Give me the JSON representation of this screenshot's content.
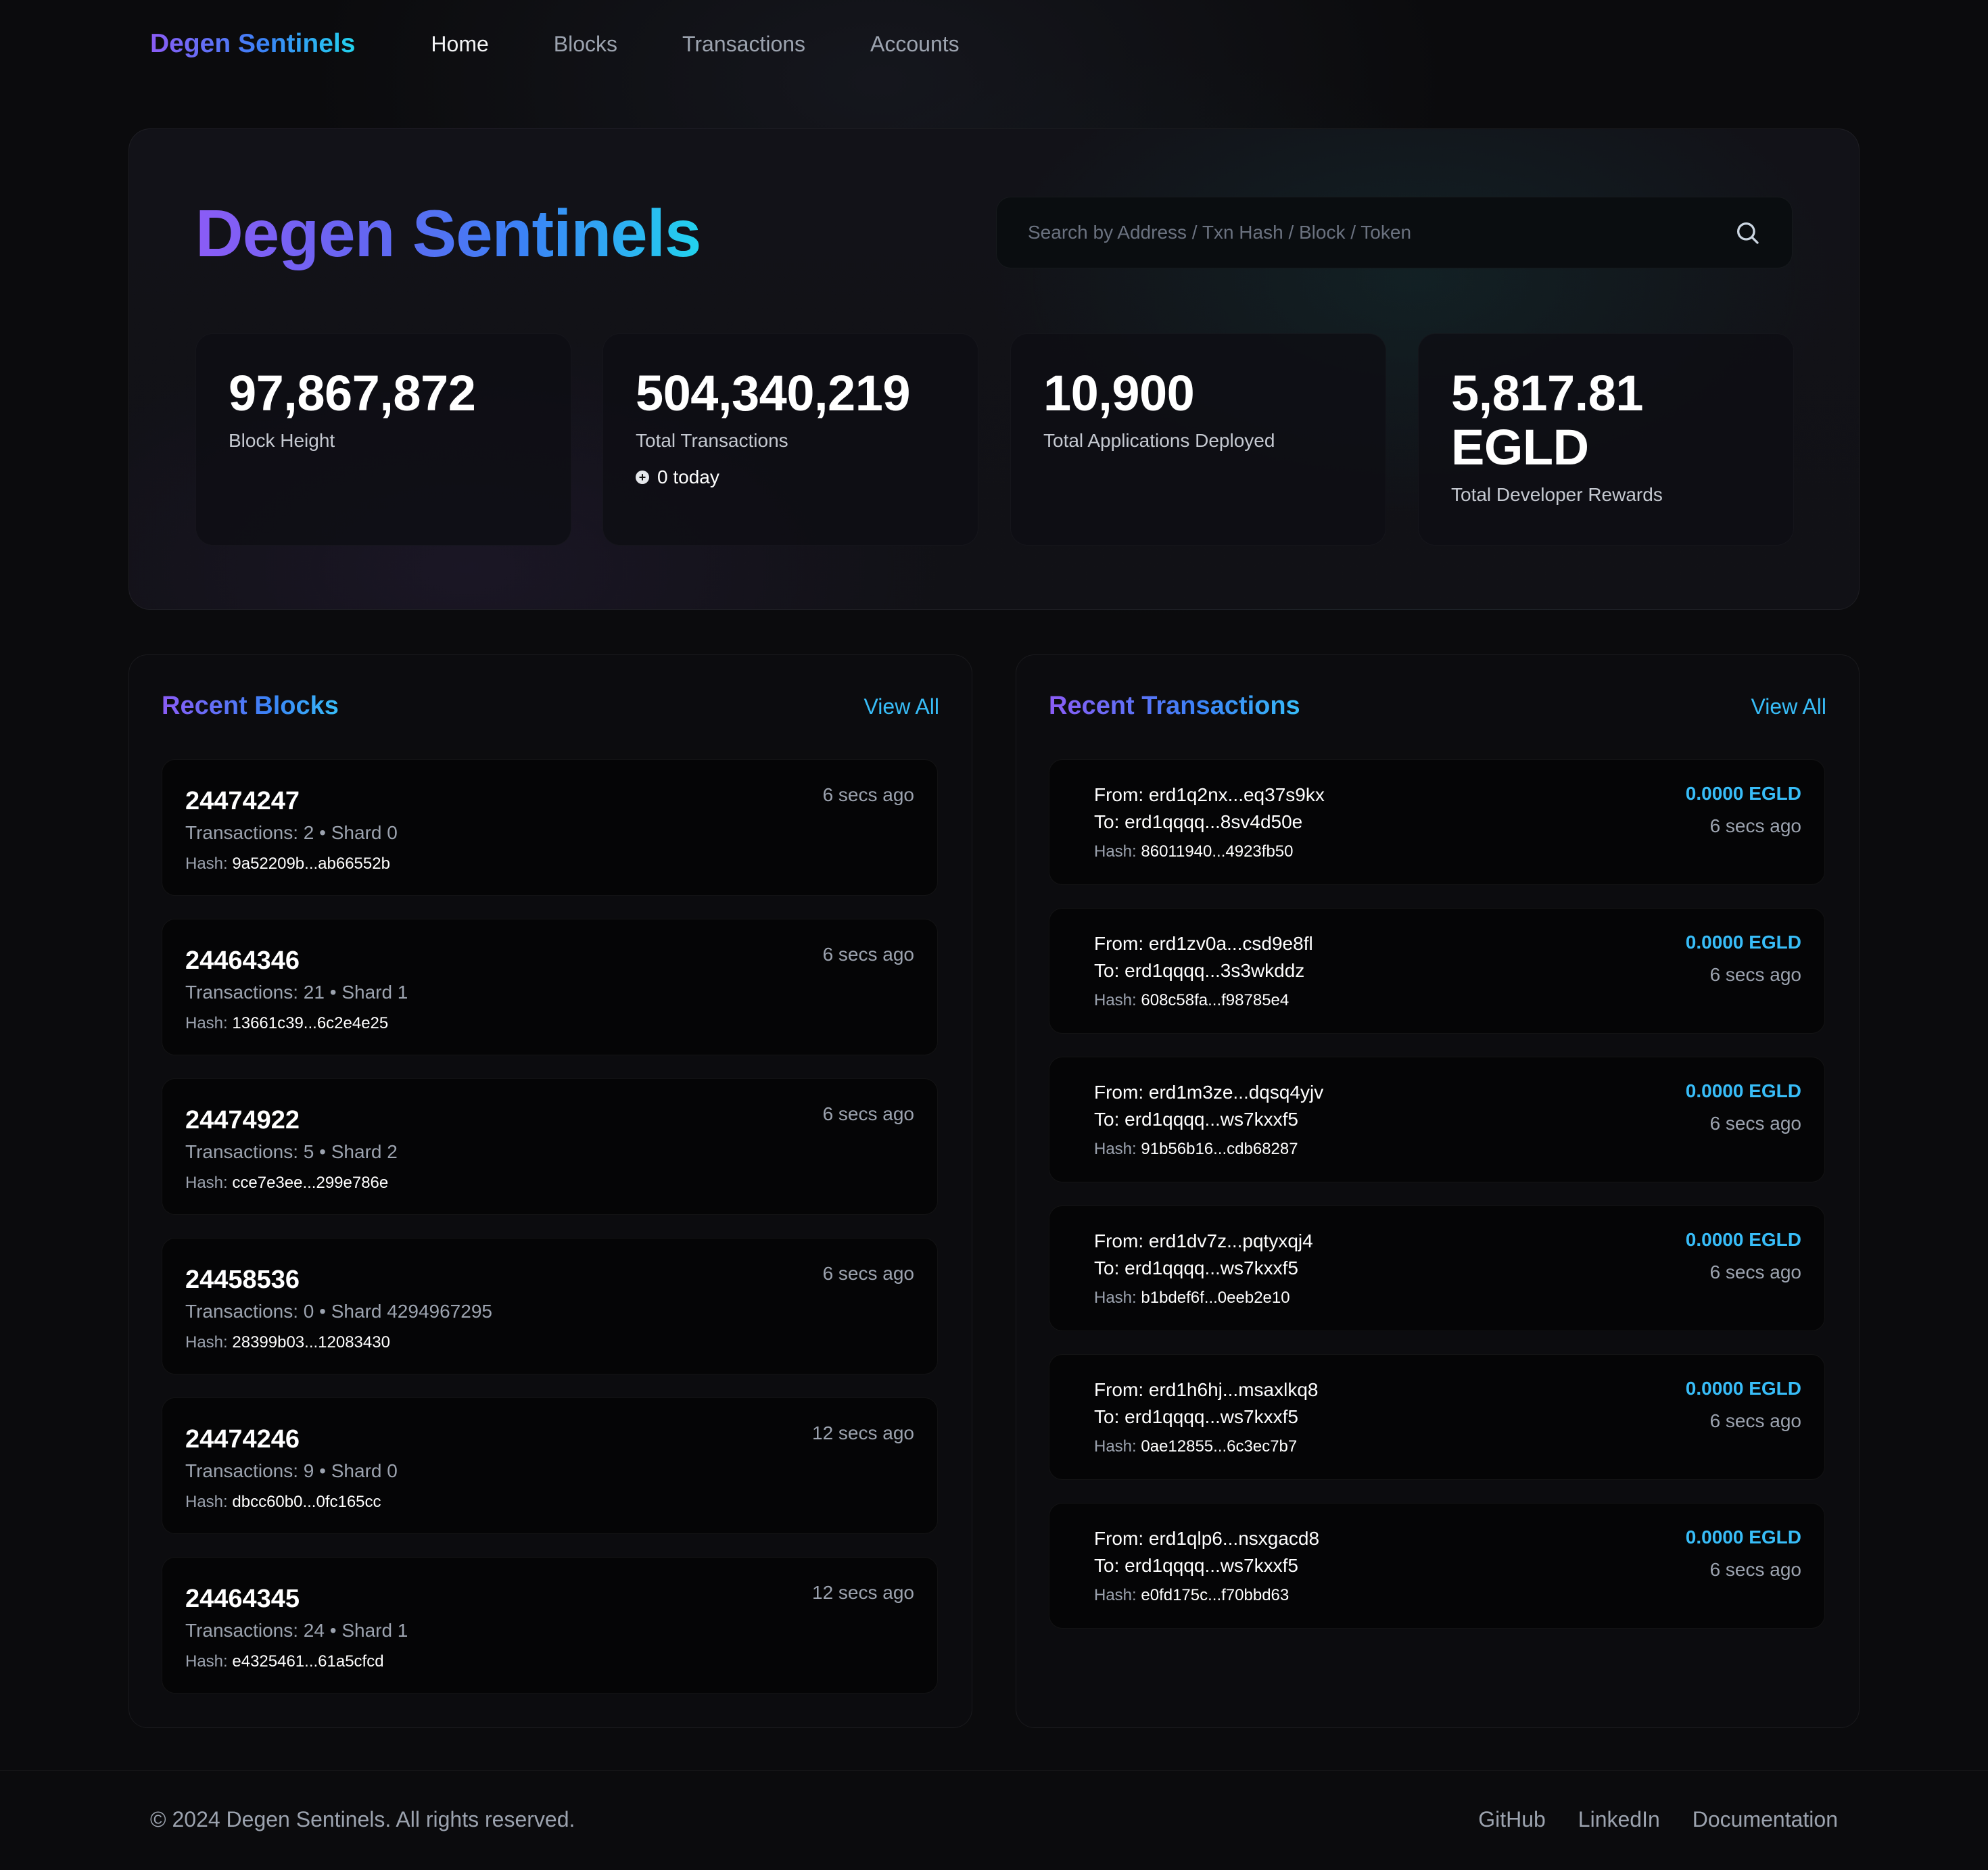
{
  "nav": {
    "brand": "Degen Sentinels",
    "links": [
      {
        "label": "Home",
        "active": true
      },
      {
        "label": "Blocks",
        "active": false
      },
      {
        "label": "Transactions",
        "active": false
      },
      {
        "label": "Accounts",
        "active": false
      }
    ]
  },
  "hero": {
    "title": "Degen Sentinels",
    "search_placeholder": "Search by Address / Txn Hash / Block / Token",
    "stats": [
      {
        "value": "97,867,872",
        "label": "Block Height"
      },
      {
        "value": "504,340,219",
        "label": "Total Transactions",
        "sub": "0 today"
      },
      {
        "value": "10,900",
        "label": "Total Applications Deployed"
      },
      {
        "value_line1": "5,817.81",
        "value_line2": "EGLD",
        "label": "Total Developer Rewards"
      }
    ]
  },
  "recent_blocks": {
    "title": "Recent Blocks",
    "view_all": "View All",
    "hash_label": "Hash:",
    "items": [
      {
        "number": "24474247",
        "meta": "Transactions: 2 • Shard 0",
        "hash": "9a52209b...ab66552b",
        "time": "6 secs ago"
      },
      {
        "number": "24464346",
        "meta": "Transactions: 21 • Shard 1",
        "hash": "13661c39...6c2e4e25",
        "time": "6 secs ago"
      },
      {
        "number": "24474922",
        "meta": "Transactions: 5 • Shard 2",
        "hash": "cce7e3ee...299e786e",
        "time": "6 secs ago"
      },
      {
        "number": "24458536",
        "meta": "Transactions: 0 • Shard 4294967295",
        "hash": "28399b03...12083430",
        "time": "6 secs ago"
      },
      {
        "number": "24474246",
        "meta": "Transactions: 9 • Shard 0",
        "hash": "dbcc60b0...0fc165cc",
        "time": "12 secs ago"
      },
      {
        "number": "24464345",
        "meta": "Transactions: 24 • Shard 1",
        "hash": "e4325461...61a5cfcd",
        "time": "12 secs ago"
      }
    ]
  },
  "recent_transactions": {
    "title": "Recent Transactions",
    "view_all": "View All",
    "hash_label": "Hash:",
    "items": [
      {
        "from": "From: erd1q2nx...eq37s9kx",
        "to": "To: erd1qqqq...8sv4d50e",
        "hash": "86011940...4923fb50",
        "amount": "0.0000 EGLD",
        "time": "6 secs ago"
      },
      {
        "from": "From: erd1zv0a...csd9e8fl",
        "to": "To: erd1qqqq...3s3wkddz",
        "hash": "608c58fa...f98785e4",
        "amount": "0.0000 EGLD",
        "time": "6 secs ago"
      },
      {
        "from": "From: erd1m3ze...dqsq4yjv",
        "to": "To: erd1qqqq...ws7kxxf5",
        "hash": "91b56b16...cdb68287",
        "amount": "0.0000 EGLD",
        "time": "6 secs ago"
      },
      {
        "from": "From: erd1dv7z...pqtyxqj4",
        "to": "To: erd1qqqq...ws7kxxf5",
        "hash": "b1bdef6f...0eeb2e10",
        "amount": "0.0000 EGLD",
        "time": "6 secs ago"
      },
      {
        "from": "From: erd1h6hj...msaxlkq8",
        "to": "To: erd1qqqq...ws7kxxf5",
        "hash": "0ae12855...6c3ec7b7",
        "amount": "0.0000 EGLD",
        "time": "6 secs ago"
      },
      {
        "from": "From: erd1qlp6...nsxgacd8",
        "to": "To: erd1qqqq...ws7kxxf5",
        "hash": "e0fd175c...f70bbd63",
        "amount": "0.0000 EGLD",
        "time": "6 secs ago"
      }
    ]
  },
  "footer": {
    "copyright": "© 2024 Degen Sentinels. All rights reserved.",
    "links": [
      "GitHub",
      "LinkedIn",
      "Documentation"
    ]
  },
  "icons": {
    "search": "search-icon",
    "today_indicator": "plus-circle-icon"
  },
  "colors": {
    "accent": "#38bdf8",
    "gradient_start": "#8b5cf6",
    "gradient_end": "#22d3ee",
    "background": "#0b0b0d"
  }
}
